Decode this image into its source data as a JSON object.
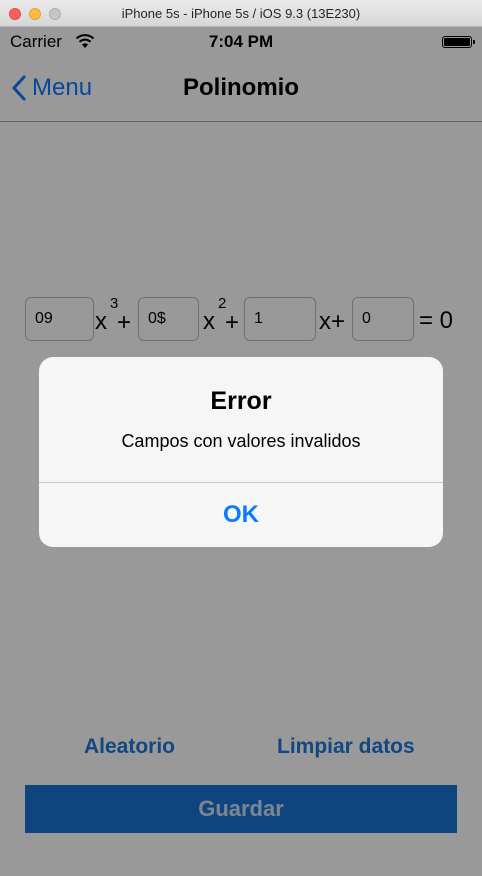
{
  "window": {
    "title": "iPhone 5s - iPhone 5s / iOS 9.3 (13E230)"
  },
  "statusbar": {
    "carrier": "Carrier",
    "time": "7:04 PM"
  },
  "navbar": {
    "back_label": "Menu",
    "title": "Polinomio"
  },
  "polynomial": {
    "coef_a": "09",
    "term_a": "x",
    "exp_a": "3",
    "plus_1": "+",
    "coef_b": "0$",
    "term_b": "x",
    "exp_b": "2",
    "plus_2": "+",
    "coef_c": "1",
    "term_c": "x+",
    "coef_d": "0",
    "equals": "= 0"
  },
  "actions": {
    "random_label": "Aleatorio",
    "clear_label": "Limpiar datos",
    "save_label": "Guardar"
  },
  "alert": {
    "title": "Error",
    "message": "Campos con valores invalidos",
    "ok_label": "OK"
  },
  "colors": {
    "accent": "#0a7aff",
    "save_button": "#1a73d4",
    "link": "#1f77d6"
  }
}
